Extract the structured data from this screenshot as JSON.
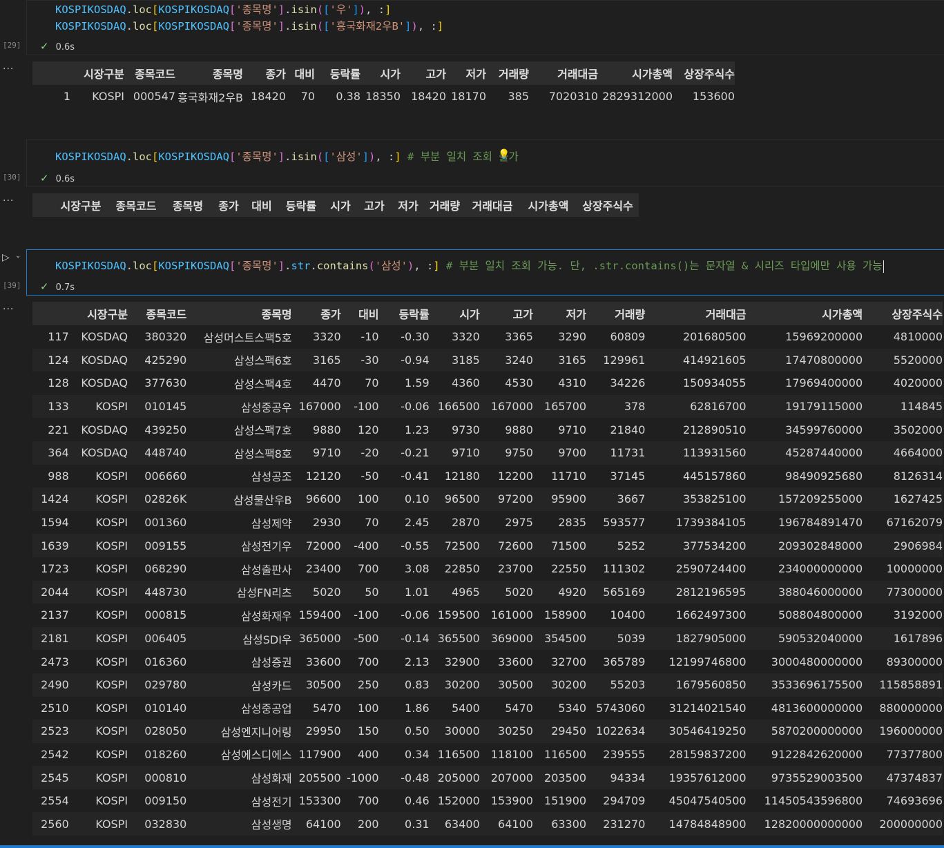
{
  "cells": [
    {
      "exec_count": "[29]",
      "status_time": "0.6s",
      "code_lines": [
        [
          {
            "t": "var",
            "v": "KOSPIKOSDAQ"
          },
          {
            "t": "pun",
            "v": "."
          },
          {
            "t": "fn",
            "v": "loc"
          },
          {
            "t": "br1",
            "v": "["
          },
          {
            "t": "var",
            "v": "KOSPIKOSDAQ"
          },
          {
            "t": "br2",
            "v": "["
          },
          {
            "t": "str",
            "v": "'종목명'"
          },
          {
            "t": "br2",
            "v": "]"
          },
          {
            "t": "pun",
            "v": "."
          },
          {
            "t": "fn",
            "v": "isin"
          },
          {
            "t": "br2",
            "v": "("
          },
          {
            "t": "br3",
            "v": "["
          },
          {
            "t": "str",
            "v": "'우'"
          },
          {
            "t": "br3",
            "v": "]"
          },
          {
            "t": "br2",
            "v": ")"
          },
          {
            "t": "pun",
            "v": ", :"
          },
          {
            "t": "br1",
            "v": "]"
          }
        ],
        [
          {
            "t": "var",
            "v": "KOSPIKOSDAQ"
          },
          {
            "t": "pun",
            "v": "."
          },
          {
            "t": "fn",
            "v": "loc"
          },
          {
            "t": "br1",
            "v": "["
          },
          {
            "t": "var",
            "v": "KOSPIKOSDAQ"
          },
          {
            "t": "br2",
            "v": "["
          },
          {
            "t": "str",
            "v": "'종목명'"
          },
          {
            "t": "br2",
            "v": "]"
          },
          {
            "t": "pun",
            "v": "."
          },
          {
            "t": "fn",
            "v": "isin"
          },
          {
            "t": "br2",
            "v": "("
          },
          {
            "t": "br3",
            "v": "["
          },
          {
            "t": "str",
            "v": "'흥국화재2우B'"
          },
          {
            "t": "br3",
            "v": "]"
          },
          {
            "t": "br2",
            "v": ")"
          },
          {
            "t": "pun",
            "v": ", :"
          },
          {
            "t": "br1",
            "v": "]"
          }
        ]
      ],
      "output": {
        "headers": [
          "",
          "시장구분",
          "종목코드",
          "종목명",
          "종가",
          "대비",
          "등락률",
          "시가",
          "고가",
          "저가",
          "거래량",
          "거래대금",
          "시가총액",
          "상장주식수"
        ],
        "rows": [
          [
            "1",
            "KOSPI",
            "000547",
            "흥국화재2우B",
            "18420",
            "70",
            "0.38",
            "18350",
            "18420",
            "18170",
            "385",
            "7020310",
            "2829312000",
            "153600"
          ]
        ]
      }
    },
    {
      "exec_count": "[30]",
      "status_time": "0.6s",
      "code_lines": [
        [
          {
            "t": "var",
            "v": "KOSPIKOSDAQ"
          },
          {
            "t": "pun",
            "v": "."
          },
          {
            "t": "fn",
            "v": "loc"
          },
          {
            "t": "br1",
            "v": "["
          },
          {
            "t": "var",
            "v": "KOSPIKOSDAQ"
          },
          {
            "t": "br2",
            "v": "["
          },
          {
            "t": "str",
            "v": "'종목명'"
          },
          {
            "t": "br2",
            "v": "]"
          },
          {
            "t": "pun",
            "v": "."
          },
          {
            "t": "fn",
            "v": "isin"
          },
          {
            "t": "br2",
            "v": "("
          },
          {
            "t": "br3",
            "v": "["
          },
          {
            "t": "str",
            "v": "'삼성'"
          },
          {
            "t": "br3",
            "v": "]"
          },
          {
            "t": "br2",
            "v": ")"
          },
          {
            "t": "pun",
            "v": ", :"
          },
          {
            "t": "br1",
            "v": "]"
          },
          {
            "t": "cm",
            "v": " # 부분 일치 조회 불가"
          }
        ]
      ],
      "output": {
        "headers": [
          "",
          "시장구분",
          "종목코드",
          "종목명",
          "종가",
          "대비",
          "등락률",
          "시가",
          "고가",
          "저가",
          "거래량",
          "거래대금",
          "시가총액",
          "상장주식수"
        ],
        "rows": []
      }
    },
    {
      "exec_count": "[39]",
      "status_time": "0.7s",
      "code_lines": [
        [
          {
            "t": "var",
            "v": "KOSPIKOSDAQ"
          },
          {
            "t": "pun",
            "v": "."
          },
          {
            "t": "fn",
            "v": "loc"
          },
          {
            "t": "br1",
            "v": "["
          },
          {
            "t": "var",
            "v": "KOSPIKOSDAQ"
          },
          {
            "t": "br2",
            "v": "["
          },
          {
            "t": "str",
            "v": "'종목명'"
          },
          {
            "t": "br2",
            "v": "]"
          },
          {
            "t": "pun",
            "v": "."
          },
          {
            "t": "var",
            "v": "str"
          },
          {
            "t": "pun",
            "v": "."
          },
          {
            "t": "fn",
            "v": "contains"
          },
          {
            "t": "br2",
            "v": "("
          },
          {
            "t": "str",
            "v": "'삼성'"
          },
          {
            "t": "br2",
            "v": ")"
          },
          {
            "t": "pun",
            "v": ", :"
          },
          {
            "t": "br1",
            "v": "]"
          },
          {
            "t": "cm",
            "v": " # 부분 일치 조회 가능. 단, .str.contains()는 문자열 & 시리즈 타입에만 사용 가능"
          }
        ]
      ],
      "output": {
        "headers": [
          "",
          "시장구분",
          "종목코드",
          "종목명",
          "종가",
          "대비",
          "등락률",
          "시가",
          "고가",
          "저가",
          "거래량",
          "거래대금",
          "시가총액",
          "상장주식수"
        ],
        "rows": [
          [
            "117",
            "KOSDAQ",
            "380320",
            "삼성머스트스팩5호",
            "3320",
            "-10",
            "-0.30",
            "3320",
            "3365",
            "3290",
            "60809",
            "201680500",
            "15969200000",
            "4810000"
          ],
          [
            "124",
            "KOSDAQ",
            "425290",
            "삼성스팩6호",
            "3165",
            "-30",
            "-0.94",
            "3185",
            "3240",
            "3165",
            "129961",
            "414921605",
            "17470800000",
            "5520000"
          ],
          [
            "128",
            "KOSDAQ",
            "377630",
            "삼성스팩4호",
            "4470",
            "70",
            "1.59",
            "4360",
            "4530",
            "4310",
            "34226",
            "150934055",
            "17969400000",
            "4020000"
          ],
          [
            "133",
            "KOSPI",
            "010145",
            "삼성중공우",
            "167000",
            "-100",
            "-0.06",
            "166500",
            "167000",
            "165700",
            "378",
            "62816700",
            "19179115000",
            "114845"
          ],
          [
            "221",
            "KOSDAQ",
            "439250",
            "삼성스팩7호",
            "9880",
            "120",
            "1.23",
            "9730",
            "9880",
            "9710",
            "21840",
            "212890510",
            "34599760000",
            "3502000"
          ],
          [
            "364",
            "KOSDAQ",
            "448740",
            "삼성스팩8호",
            "9710",
            "-20",
            "-0.21",
            "9710",
            "9750",
            "9700",
            "11731",
            "113931560",
            "45287440000",
            "4664000"
          ],
          [
            "988",
            "KOSPI",
            "006660",
            "삼성공조",
            "12120",
            "-50",
            "-0.41",
            "12180",
            "12200",
            "11710",
            "37145",
            "445157860",
            "98490925680",
            "8126314"
          ],
          [
            "1424",
            "KOSPI",
            "02826K",
            "삼성물산우B",
            "96600",
            "100",
            "0.10",
            "96500",
            "97200",
            "95900",
            "3667",
            "353825100",
            "157209255000",
            "1627425"
          ],
          [
            "1594",
            "KOSPI",
            "001360",
            "삼성제약",
            "2930",
            "70",
            "2.45",
            "2870",
            "2975",
            "2835",
            "593577",
            "1739384105",
            "196784891470",
            "67162079"
          ],
          [
            "1639",
            "KOSPI",
            "009155",
            "삼성전기우",
            "72000",
            "-400",
            "-0.55",
            "72500",
            "72600",
            "71500",
            "5252",
            "377534200",
            "209302848000",
            "2906984"
          ],
          [
            "1723",
            "KOSPI",
            "068290",
            "삼성출판사",
            "23400",
            "700",
            "3.08",
            "22850",
            "23700",
            "22550",
            "111302",
            "2590724400",
            "234000000000",
            "10000000"
          ],
          [
            "2044",
            "KOSPI",
            "448730",
            "삼성FN리츠",
            "5020",
            "50",
            "1.01",
            "4965",
            "5020",
            "4920",
            "565169",
            "2812196595",
            "388046000000",
            "77300000"
          ],
          [
            "2137",
            "KOSPI",
            "000815",
            "삼성화재우",
            "159400",
            "-100",
            "-0.06",
            "159500",
            "161000",
            "158900",
            "10400",
            "1662497300",
            "508804800000",
            "3192000"
          ],
          [
            "2181",
            "KOSPI",
            "006405",
            "삼성SDI우",
            "365000",
            "-500",
            "-0.14",
            "365500",
            "369000",
            "354500",
            "5039",
            "1827905000",
            "590532040000",
            "1617896"
          ],
          [
            "2473",
            "KOSPI",
            "016360",
            "삼성증권",
            "33600",
            "700",
            "2.13",
            "32900",
            "33600",
            "32700",
            "365789",
            "12199746800",
            "3000480000000",
            "89300000"
          ],
          [
            "2490",
            "KOSPI",
            "029780",
            "삼성카드",
            "30500",
            "250",
            "0.83",
            "30200",
            "30500",
            "30200",
            "55203",
            "1679560850",
            "3533696175500",
            "115858891"
          ],
          [
            "2510",
            "KOSPI",
            "010140",
            "삼성중공업",
            "5470",
            "100",
            "1.86",
            "5400",
            "5470",
            "5340",
            "5743060",
            "31214021540",
            "4813600000000",
            "880000000"
          ],
          [
            "2523",
            "KOSPI",
            "028050",
            "삼성엔지니어링",
            "29950",
            "150",
            "0.50",
            "30000",
            "30250",
            "29450",
            "1022634",
            "30546419250",
            "5870200000000",
            "196000000"
          ],
          [
            "2542",
            "KOSPI",
            "018260",
            "삼성에스디에스",
            "117900",
            "400",
            "0.34",
            "116500",
            "118100",
            "116500",
            "239555",
            "28159837200",
            "9122842620000",
            "77377800"
          ],
          [
            "2545",
            "KOSPI",
            "000810",
            "삼성화재",
            "205500",
            "-1000",
            "-0.48",
            "205000",
            "207000",
            "203500",
            "94334",
            "19357612000",
            "9735529003500",
            "47374837"
          ],
          [
            "2554",
            "KOSPI",
            "009150",
            "삼성전기",
            "153300",
            "700",
            "0.46",
            "152000",
            "153900",
            "151900",
            "294709",
            "45047540500",
            "11450543596800",
            "74693696"
          ],
          [
            "2560",
            "KOSPI",
            "032830",
            "삼성생명",
            "64100",
            "200",
            "0.31",
            "63400",
            "64100",
            "63300",
            "231270",
            "14784848900",
            "12820000000000",
            "200000000"
          ]
        ]
      }
    }
  ],
  "ellipsis": "···"
}
